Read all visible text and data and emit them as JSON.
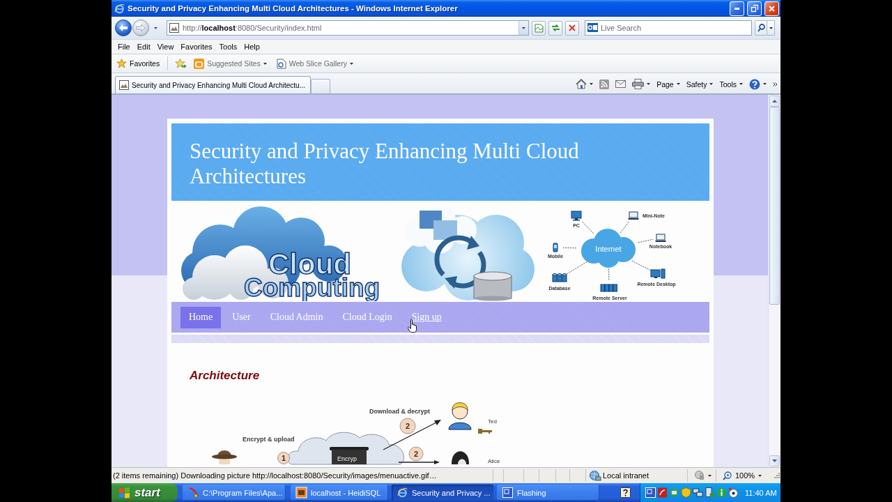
{
  "window": {
    "title": "Security and Privacy Enhancing Multi Cloud Architectures - Windows Internet Explorer"
  },
  "address_bar": {
    "url": "http://**localhost**:8080/Security/index.html"
  },
  "search": {
    "placeholder": "Live Search"
  },
  "menu_bar": [
    "File",
    "Edit",
    "View",
    "Favorites",
    "Tools",
    "Help"
  ],
  "favorites_bar": {
    "label": "Favorites",
    "links": [
      "Suggested Sites",
      "Web Slice Gallery"
    ]
  },
  "tabs": [
    {
      "label": "Security and Privacy Enhancing Multi Cloud Architectu...",
      "selected": true
    }
  ],
  "command_bar": [
    "Page",
    "Safety",
    "Tools"
  ],
  "page": {
    "title": "Security and Privacy Enhancing Multi Cloud Architectures",
    "banner": {
      "logo_text": [
        "Cloud",
        "Computing"
      ],
      "network_hub": "Internet",
      "network_nodes": [
        {
          "kind": "monitor",
          "label": "PC"
        },
        {
          "kind": "laptop",
          "label": "Mini-Note"
        },
        {
          "kind": "laptop",
          "label": "Notebook"
        },
        {
          "kind": "phone",
          "label": "Mobile"
        },
        {
          "kind": "database",
          "label": "Database"
        },
        {
          "kind": "server",
          "label": "Remote Server"
        },
        {
          "kind": "desktop",
          "label": "Remote Desktop"
        }
      ]
    },
    "nav": [
      {
        "label": "Home",
        "selected": true,
        "hovered": false
      },
      {
        "label": "User",
        "selected": false,
        "hovered": false
      },
      {
        "label": "Cloud Admin",
        "selected": false,
        "hovered": false
      },
      {
        "label": "Cloud Login",
        "selected": false,
        "hovered": false
      },
      {
        "label": "Sign up",
        "selected": false,
        "hovered": true
      }
    ],
    "heading": "Architecture",
    "diagram": {
      "labels": {
        "download": "Download & decrypt",
        "upload": "Encrypt & upload",
        "recipient_1": "Ted",
        "recipient_2": "Alice",
        "file": "Encryp"
      },
      "steps": [
        "2",
        "1",
        "2"
      ]
    }
  },
  "status_bar": {
    "message": "(2 items remaining) Downloading picture http://localhost:8080/Security/images/menuactive.gif…",
    "zone": "Local intranet",
    "zoom": "100%"
  },
  "taskbar": {
    "start": "start",
    "tasks": [
      {
        "label": "C:\\Program Files\\Apa...",
        "selected": false
      },
      {
        "label": "localhost - HeidiSQL",
        "selected": false
      },
      {
        "label": "Security and Privacy ...",
        "selected": true
      },
      {
        "label": "Flashing",
        "selected": false
      }
    ],
    "clock": "11:40 AM"
  }
}
